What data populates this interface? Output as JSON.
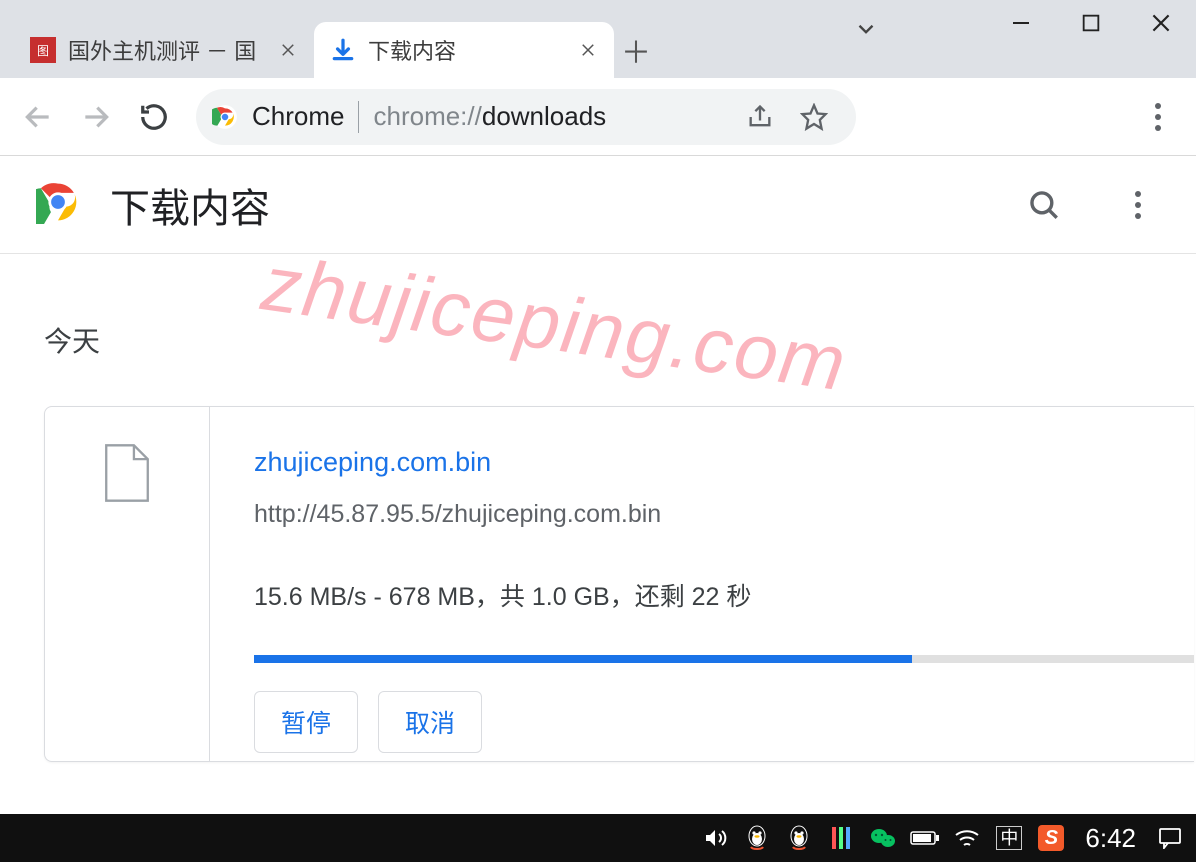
{
  "tabs": {
    "inactive": {
      "title": "国外主机测评 － 国"
    },
    "active": {
      "title": "下载内容"
    }
  },
  "omnibox": {
    "label": "Chrome",
    "url_prefix": "chrome://",
    "url_path": "downloads"
  },
  "page": {
    "title": "下载内容",
    "section_today": "今天"
  },
  "download": {
    "filename": "zhujiceping.com.bin",
    "url": "http://45.87.95.5/zhujiceping.com.bin",
    "status": "15.6 MB/s - 678 MB，共 1.0 GB，还剩 22 秒",
    "progress_percent": 70,
    "pause_label": "暂停",
    "cancel_label": "取消"
  },
  "watermark": "zhujiceping.com",
  "taskbar": {
    "ime": "中",
    "clock": "6:42"
  }
}
